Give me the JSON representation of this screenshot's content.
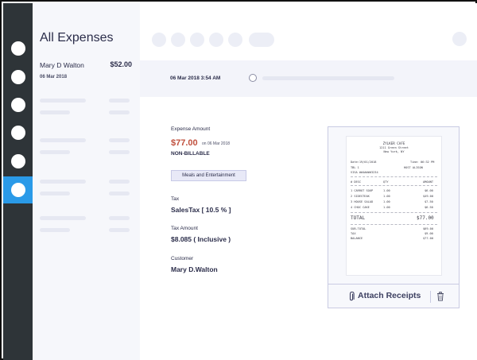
{
  "nav": {
    "items": [
      {
        "icon": "nav-dot-icon",
        "active": false
      },
      {
        "icon": "nav-dot-icon",
        "active": false
      },
      {
        "icon": "nav-dot-icon",
        "active": false
      },
      {
        "icon": "nav-dot-icon",
        "active": false
      },
      {
        "icon": "nav-dot-icon",
        "active": false
      },
      {
        "icon": "nav-dot-icon",
        "active": true
      }
    ],
    "active_color": "#2a9ae8"
  },
  "list": {
    "title": "All Expenses",
    "selected": {
      "name": "Mary D Walton",
      "amount": "$52.00",
      "date": "06 Mar 2018"
    }
  },
  "timeline": {
    "datetime": "06 Mar 2018 3:54 AM"
  },
  "expense": {
    "amount_label": "Expense Amount",
    "amount": "$77.00",
    "amount_date": "on 06 Mar 2018",
    "billable": "NON-BILLABLE",
    "category": "Meals and Entertainment",
    "tax_label": "Tax",
    "tax_value": "SalesTax [ 10.5 % ]",
    "tax_amount_label": "Tax Amount",
    "tax_amount_value": "$8.085 ( Inclusive )",
    "customer_label": "Customer",
    "customer_value": "Mary D.Walton",
    "amount_color": "#c0503d"
  },
  "receipt": {
    "store": "ZYLKER CAFE",
    "street": "1211 Green Street",
    "city": "New York, NY",
    "date": "Date:19/01/2018",
    "time": "Time: 06:32 PM",
    "table": "TBL 1",
    "host": "HOST ALISON",
    "card": "VISA ##4####3234",
    "header_desc": "# DESC",
    "header_qty": "QTY",
    "header_amt": "AMOUNT",
    "items": [
      {
        "desc": "1 CARROT SOUP",
        "qty": "1.00",
        "amt": "$6.00"
      },
      {
        "desc": "2 SIDESTEAK",
        "qty": "1.00",
        "amt": "$49.00"
      },
      {
        "desc": "3 HOUSE SALAD",
        "qty": "1.00",
        "amt": "$7.50"
      },
      {
        "desc": "4 CHOC CAKE",
        "qty": "1.00",
        "amt": "$6.50"
      }
    ],
    "total_label": "TOTAL",
    "total_value": "$77.00",
    "subtotal_label": "SUB-TOTAL",
    "subtotal_value": "$69.00",
    "tax_label": "TAX",
    "tax_value": "$9.00",
    "balance_label": "BALANCE",
    "balance_value": "$77.00"
  },
  "actions": {
    "attach_label": "Attach Receipts",
    "attach_icon": "paperclip-icon",
    "delete_icon": "trash-icon"
  }
}
